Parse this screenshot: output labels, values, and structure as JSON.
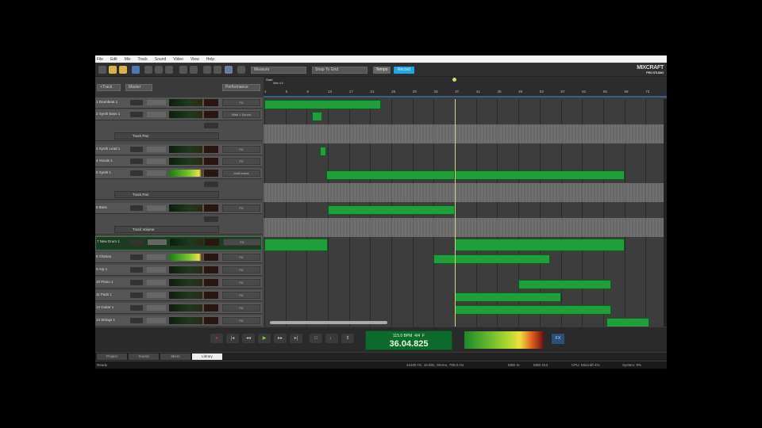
{
  "menu": [
    "File",
    "Edit",
    "Mix",
    "Track",
    "Sound",
    "Video",
    "View",
    "Help"
  ],
  "toolbar": {
    "snap_select": "Measure",
    "key_select": "Snap To Grid",
    "tempo_button": "Tempo",
    "record_button": "Record",
    "logo": "MIXCRAFT PRO STUDIO",
    "accent": "#1ea7e8"
  },
  "header": {
    "add_track": "+Track",
    "master": "Master",
    "performance": "Performance"
  },
  "ruler": {
    "marker": "Start",
    "marker_sub": "Intro 4:4",
    "bars": [
      1,
      5,
      9,
      13,
      17,
      21,
      25,
      29,
      33,
      37,
      41,
      45,
      49,
      53,
      57,
      61,
      65,
      69,
      73
    ]
  },
  "tracks": [
    {
      "name": "1 Drumbeat 1",
      "fx": "FX",
      "meter": "low",
      "clips": [
        [
          1,
          23
        ]
      ]
    },
    {
      "name": "2 Synth Bass 1",
      "fx": "Wah 1 Sound",
      "meter": "low",
      "clips": [
        [
          10,
          12
        ]
      ],
      "automation": "Track Pan"
    },
    {
      "name": "3 Synth Lead 1",
      "fx": "FX",
      "meter": "low",
      "clips": [
        [
          11.5,
          12.7
        ]
      ]
    },
    {
      "name": "4 Vocals 1",
      "fx": "FX",
      "meter": "low",
      "clips": []
    },
    {
      "name": "5 Synth 1",
      "fx": "Instrument",
      "meter": "hot",
      "clips": [
        [
          12.7,
          37
        ],
        [
          37,
          69
        ]
      ],
      "automation": "Track Pan"
    },
    {
      "name": "6 Bass",
      "fx": "FX",
      "meter": "low",
      "clips": [
        [
          13,
          37
        ]
      ],
      "automation": "Track Volume"
    },
    {
      "name": "7 New Drum 1",
      "fx": "FX",
      "meter": "low",
      "selected": true,
      "clips": [
        [
          1,
          13
        ],
        [
          37,
          69
        ]
      ]
    },
    {
      "name": "8 Chimes",
      "fx": "FX",
      "meter": "hot",
      "clips": [
        [
          33,
          55
        ]
      ]
    },
    {
      "name": "9 Arp 1",
      "fx": "FX",
      "meter": "low",
      "clips": []
    },
    {
      "name": "10 Piano 1",
      "fx": "FX",
      "meter": "low",
      "clips": [
        [
          49,
          66.5
        ]
      ]
    },
    {
      "name": "11 Pads 1",
      "fx": "FX",
      "meter": "low",
      "clips": [
        [
          37,
          57
        ]
      ]
    },
    {
      "name": "12 Guitar 1",
      "fx": "FX",
      "meter": "low",
      "clips": [
        [
          37,
          66.5
        ]
      ]
    },
    {
      "name": "13 Strings 1",
      "fx": "FX",
      "meter": "low",
      "clips": [
        [
          65.6,
          73.7
        ]
      ]
    }
  ],
  "playhead_bar": 37,
  "transport": {
    "tempo": "115.0 BPM",
    "signature": "4/4",
    "key": "F",
    "time": "36.04.825",
    "fx_button": "FX"
  },
  "tabs": [
    "Project",
    "Sound",
    "Mixer",
    "Library"
  ],
  "status": {
    "left": "Ready",
    "format": "44100 Hz, 16 Bits, Stereo, 790.0 ms",
    "midi_in": "MIDI In",
    "midi_out": "MIDI Out",
    "cpu": "CPU: Mixcraft 4%",
    "system": "System: 8%"
  }
}
